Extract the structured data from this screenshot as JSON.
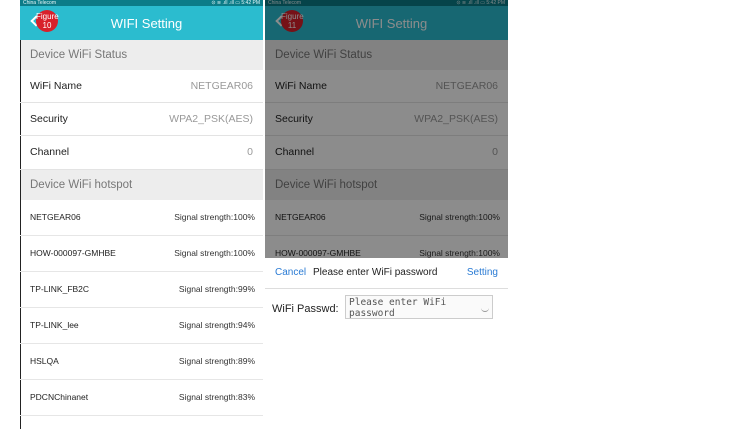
{
  "statusbar": {
    "carrier": "China Telecom",
    "right": "⊙ ≋ .ıll .ıll ▭ 5:42 PM"
  },
  "header": {
    "title": "WIFI Setting"
  },
  "figures": {
    "left": "Figure 10",
    "right": "Figure 11"
  },
  "status_section": {
    "label": "Device WiFi Status",
    "rows": [
      {
        "label": "WiFi Name",
        "value": "NETGEAR06"
      },
      {
        "label": "Security",
        "value": "WPA2_PSK(AES)"
      },
      {
        "label": "Channel",
        "value": "0"
      }
    ]
  },
  "hotspot_section": {
    "label": "Device WiFi hotspot",
    "items": [
      {
        "ssid": "NETGEAR06",
        "signal": "Signal strength:100%"
      },
      {
        "ssid": "HOW-000097-GMHBE",
        "signal": "Signal strength:100%"
      },
      {
        "ssid": "TP-LINK_FB2C",
        "signal": "Signal strength:99%"
      },
      {
        "ssid": "TP-LINK_lee",
        "signal": "Signal strength:94%"
      },
      {
        "ssid": "HSLQA",
        "signal": "Signal strength:89%"
      },
      {
        "ssid": "PDCNChinanet",
        "signal": "Signal strength:83%"
      }
    ]
  },
  "dialog": {
    "cancel": "Cancel",
    "title": "Please enter WiFi password",
    "setting": "Setting",
    "password_label": "WiFi Passwd:",
    "password_placeholder": "Please enter WiFi password"
  },
  "colors": {
    "header": "#2bbccf",
    "badge": "#d8202a",
    "link": "#2a7bd4"
  }
}
